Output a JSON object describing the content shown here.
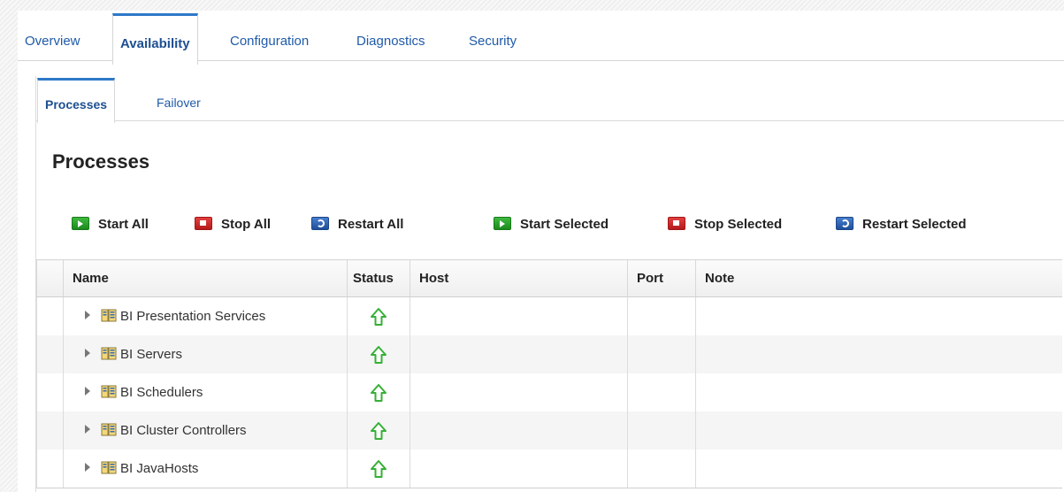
{
  "tabs": [
    "Overview",
    "Availability",
    "Configuration",
    "Diagnostics",
    "Security"
  ],
  "active_tab": "Availability",
  "subtabs": [
    "Processes",
    "Failover"
  ],
  "active_subtab": "Processes",
  "page_title": "Processes",
  "toolbar": {
    "start_all": "Start All",
    "stop_all": "Stop All",
    "restart_all": "Restart All",
    "start_selected": "Start Selected",
    "stop_selected": "Stop Selected",
    "restart_selected": "Restart Selected"
  },
  "table": {
    "columns": {
      "name": "Name",
      "status": "Status",
      "host": "Host",
      "port": "Port",
      "note": "Note"
    },
    "rows": [
      {
        "name": "BI Presentation Services",
        "status": "up-arrow-icon",
        "host": "",
        "port": "",
        "note": ""
      },
      {
        "name": "BI Servers",
        "status": "up-arrow-icon",
        "host": "",
        "port": "",
        "note": ""
      },
      {
        "name": "BI Schedulers",
        "status": "up-arrow-icon",
        "host": "",
        "port": "",
        "note": ""
      },
      {
        "name": "BI Cluster Controllers",
        "status": "up-arrow-icon",
        "host": "",
        "port": "",
        "note": ""
      },
      {
        "name": "BI JavaHosts",
        "status": "up-arrow-icon",
        "host": "",
        "port": "",
        "note": ""
      }
    ]
  },
  "colors": {
    "link": "#1f5aa8",
    "tab_accent": "#2e78c7",
    "status_up": "#35b035"
  }
}
